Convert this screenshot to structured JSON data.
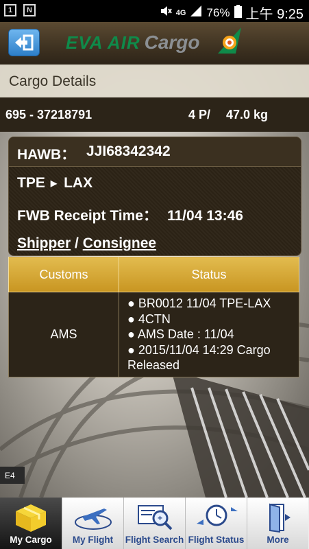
{
  "status_bar": {
    "battery_percent": "76%",
    "network": "4G",
    "time": "上午 9:25",
    "left_icons": [
      "1",
      "N"
    ]
  },
  "header": {
    "logo_primary": "EVA AIR",
    "logo_secondary": "Cargo",
    "back_icon": "back-arrow-icon"
  },
  "page": {
    "title": "Cargo Details"
  },
  "awb": {
    "number": "695 - 37218791",
    "pieces": "4 P/",
    "weight": "47.0 kg"
  },
  "details": {
    "hawb_label": "HAWB：",
    "hawb_value": "JJI68342342",
    "origin": "TPE",
    "destination": "LAX",
    "fwb_label": "FWB Receipt Time：",
    "fwb_time": "11/04 13:46",
    "shipper_link": "Shipper",
    "separator": " / ",
    "consignee_link": "Consignee"
  },
  "customs_table": {
    "headers": [
      "Customs",
      "Status"
    ],
    "rows": [
      {
        "customs": "AMS",
        "status": [
          "● BR0012 11/04 TPE-LAX",
          "● 4CTN",
          "● AMS Date : 11/04",
          "● 2015/11/04 14:29 Cargo Released"
        ]
      }
    ]
  },
  "bottom_nav": [
    {
      "label": "My Cargo",
      "icon": "cargo-box-icon",
      "active": true
    },
    {
      "label": "My Flight",
      "icon": "airplane-icon",
      "active": false
    },
    {
      "label": "Flight Search",
      "icon": "search-magnifier-icon",
      "active": false
    },
    {
      "label": "Flight Status",
      "icon": "clock-airplane-icon",
      "active": false
    },
    {
      "label": "More",
      "icon": "door-icon",
      "active": false
    }
  ],
  "colors": {
    "header_brown": "#3e3221",
    "gold_header": "#d6a832",
    "brand_green": "#0f8a4a",
    "nav_label_blue": "#2b4a8c"
  }
}
